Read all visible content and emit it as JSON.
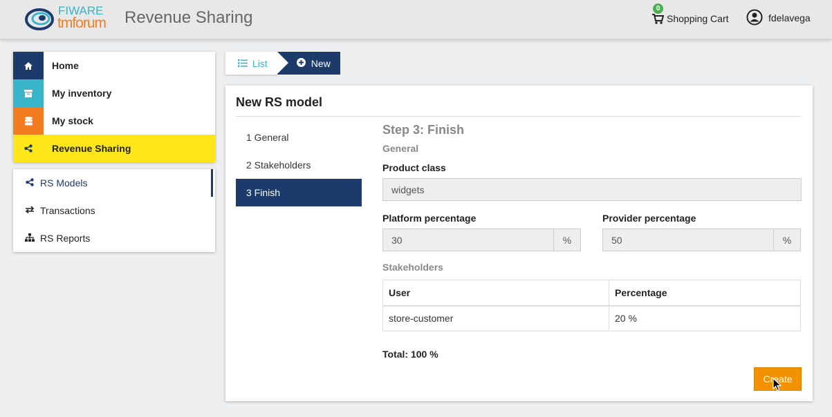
{
  "header": {
    "logo_text_top": "FIWARE",
    "logo_text_bottom": "tmforum",
    "title": "Revenue Sharing",
    "cart_count": "0",
    "cart_label": "Shopping Cart",
    "username": "fdelavega"
  },
  "menu": {
    "items": [
      {
        "label": "Home",
        "icon": "home-icon",
        "color": "#1c3b6b"
      },
      {
        "label": "My inventory",
        "icon": "archive-icon",
        "color": "#3ab4c9"
      },
      {
        "label": "My stock",
        "icon": "database-icon",
        "color": "#f47c20"
      },
      {
        "label": "Revenue Sharing",
        "icon": "share-icon",
        "color": "#fde619"
      }
    ],
    "sub_items": [
      {
        "label": "RS Models",
        "icon": "share-icon"
      },
      {
        "label": "Transactions",
        "icon": "exchange-icon"
      },
      {
        "label": "RS Reports",
        "icon": "sitemap-icon"
      }
    ]
  },
  "breadcrumb": {
    "list_label": "List",
    "new_label": "New"
  },
  "panel": {
    "title": "New RS model",
    "steps": [
      "1 General",
      "2 Stakeholders",
      "3 Finish"
    ],
    "step_title": "Step 3: Finish",
    "general_section": "General",
    "product_class_label": "Product class",
    "product_class_value": "widgets",
    "platform_label": "Platform percentage",
    "platform_value": "30",
    "provider_label": "Provider percentage",
    "provider_value": "50",
    "percent_symbol": "%",
    "stakeholders_section": "Stakeholders",
    "table": {
      "headers": [
        "User",
        "Percentage"
      ],
      "rows": [
        [
          "store-customer",
          "20 %"
        ]
      ]
    },
    "total": "Total: 100 %",
    "create_label": "Create"
  },
  "colors": {
    "accent_dark": "#1c3b6b",
    "accent_yellow": "#fde619",
    "create_orange": "#f39200"
  }
}
